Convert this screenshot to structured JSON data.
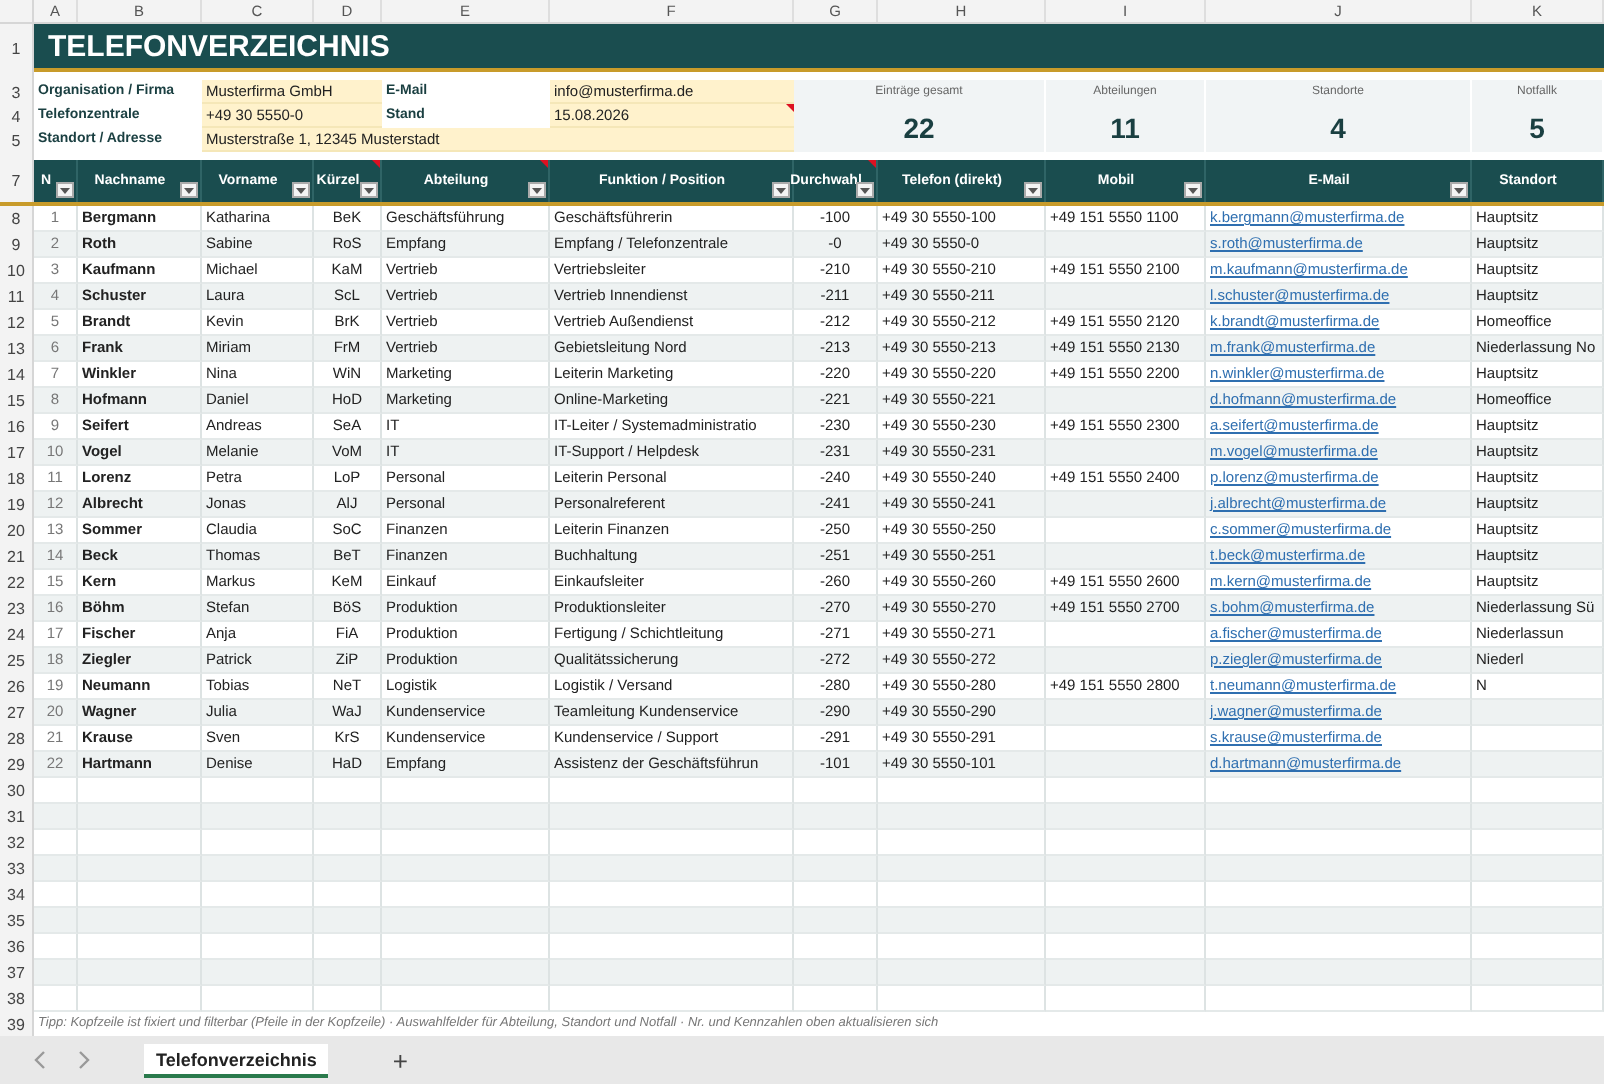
{
  "column_letters": [
    "A",
    "B",
    "C",
    "D",
    "E",
    "F",
    "G",
    "H",
    "I",
    "J",
    "K"
  ],
  "title": {
    "row_number": "1",
    "text": "TELEFONVERZEICHNIS"
  },
  "info": [
    {
      "row_number": "3",
      "label": "Organisation / Firma",
      "value": "Musterfirma GmbH",
      "label_2": "E-Mail",
      "value_2": "info@musterfirma.de",
      "comment": false
    },
    {
      "row_number": "4",
      "label": "Telefonzentrale",
      "value": "+49 30 5550-0",
      "label_2": "Stand",
      "value_2": "15.08.2026",
      "comment": true
    },
    {
      "row_number": "5",
      "label": "Standort / Adresse",
      "value": "Musterstraße 1, 12345 Musterstadt"
    }
  ],
  "kpis": [
    {
      "label": "Einträge gesamt",
      "value": "22"
    },
    {
      "label": "Abteilungen",
      "value": "11"
    },
    {
      "label": "Standorte",
      "value": "4"
    },
    {
      "label": "Notfallk",
      "value": "5"
    }
  ],
  "table": {
    "header_row_number": "7",
    "columns": [
      {
        "label": "N",
        "comment": false
      },
      {
        "label": "Nachname",
        "comment": false
      },
      {
        "label": "Vorname",
        "comment": false
      },
      {
        "label": "Kürzel",
        "comment": true
      },
      {
        "label": "Abteilung",
        "comment": true
      },
      {
        "label": "Funktion / Position",
        "comment": false
      },
      {
        "label": "Durchwahl",
        "comment": true
      },
      {
        "label": "Telefon (direkt)",
        "comment": false
      },
      {
        "label": "Mobil",
        "comment": false
      },
      {
        "label": "E-Mail",
        "comment": false
      },
      {
        "label": "Standort",
        "comment": false
      }
    ],
    "rows": [
      {
        "row_number": "8",
        "nr": "1",
        "last": "Bergmann",
        "first": "Katharina",
        "code": "BeK",
        "dept": "Geschäftsführung",
        "role": "Geschäftsführerin",
        "ext": "-100",
        "phone": "+49 30 5550-100",
        "mobile": "+49 151 5550 1100",
        "email": "k.bergmann@musterfirma.de",
        "site": "Hauptsitz"
      },
      {
        "row_number": "9",
        "nr": "2",
        "last": "Roth",
        "first": "Sabine",
        "code": "RoS",
        "dept": "Empfang",
        "role": "Empfang / Telefonzentrale",
        "ext": "-0",
        "phone": "+49 30 5550-0",
        "email": "s.roth@musterfirma.de",
        "site": "Hauptsitz"
      },
      {
        "row_number": "10",
        "nr": "3",
        "last": "Kaufmann",
        "first": "Michael",
        "code": "KaM",
        "dept": "Vertrieb",
        "role": "Vertriebsleiter",
        "ext": "-210",
        "phone": "+49 30 5550-210",
        "mobile": "+49 151 5550 2100",
        "email": "m.kaufmann@musterfirma.de",
        "site": "Hauptsitz"
      },
      {
        "row_number": "11",
        "nr": "4",
        "last": "Schuster",
        "first": "Laura",
        "code": "ScL",
        "dept": "Vertrieb",
        "role": "Vertrieb Innendienst",
        "ext": "-211",
        "phone": "+49 30 5550-211",
        "email": "l.schuster@musterfirma.de",
        "site": "Hauptsitz"
      },
      {
        "row_number": "12",
        "nr": "5",
        "last": "Brandt",
        "first": "Kevin",
        "code": "BrK",
        "dept": "Vertrieb",
        "role": "Vertrieb Außendienst",
        "ext": "-212",
        "phone": "+49 30 5550-212",
        "mobile": "+49 151 5550 2120",
        "email": "k.brandt@musterfirma.de",
        "site": "Homeoffice"
      },
      {
        "row_number": "13",
        "nr": "6",
        "last": "Frank",
        "first": "Miriam",
        "code": "FrM",
        "dept": "Vertrieb",
        "role": "Gebietsleitung Nord",
        "ext": "-213",
        "phone": "+49 30 5550-213",
        "mobile": "+49 151 5550 2130",
        "email": "m.frank@musterfirma.de",
        "site": "Niederlassung No"
      },
      {
        "row_number": "14",
        "nr": "7",
        "last": "Winkler",
        "first": "Nina",
        "code": "WiN",
        "dept": "Marketing",
        "role": "Leiterin Marketing",
        "ext": "-220",
        "phone": "+49 30 5550-220",
        "mobile": "+49 151 5550 2200",
        "email": "n.winkler@musterfirma.de",
        "site": "Hauptsitz"
      },
      {
        "row_number": "15",
        "nr": "8",
        "last": "Hofmann",
        "first": "Daniel",
        "code": "HoD",
        "dept": "Marketing",
        "role": "Online-Marketing",
        "ext": "-221",
        "phone": "+49 30 5550-221",
        "email": "d.hofmann@musterfirma.de",
        "site": "Homeoffice"
      },
      {
        "row_number": "16",
        "nr": "9",
        "last": "Seifert",
        "first": "Andreas",
        "code": "SeA",
        "dept": "IT",
        "role": "IT-Leiter / Systemadministratio",
        "ext": "-230",
        "phone": "+49 30 5550-230",
        "mobile": "+49 151 5550 2300",
        "email": "a.seifert@musterfirma.de",
        "site": "Hauptsitz"
      },
      {
        "row_number": "17",
        "nr": "10",
        "last": "Vogel",
        "first": "Melanie",
        "code": "VoM",
        "dept": "IT",
        "role": "IT-Support / Helpdesk",
        "ext": "-231",
        "phone": "+49 30 5550-231",
        "email": "m.vogel@musterfirma.de",
        "site": "Hauptsitz"
      },
      {
        "row_number": "18",
        "nr": "11",
        "last": "Lorenz",
        "first": "Petra",
        "code": "LoP",
        "dept": "Personal",
        "role": "Leiterin Personal",
        "ext": "-240",
        "phone": "+49 30 5550-240",
        "mobile": "+49 151 5550 2400",
        "email": "p.lorenz@musterfirma.de",
        "site": "Hauptsitz"
      },
      {
        "row_number": "19",
        "nr": "12",
        "last": "Albrecht",
        "first": "Jonas",
        "code": "AlJ",
        "dept": "Personal",
        "role": "Personalreferent",
        "ext": "-241",
        "phone": "+49 30 5550-241",
        "email": "j.albrecht@musterfirma.de",
        "site": "Hauptsitz"
      },
      {
        "row_number": "20",
        "nr": "13",
        "last": "Sommer",
        "first": "Claudia",
        "code": "SoC",
        "dept": "Finanzen",
        "role": "Leiterin Finanzen",
        "ext": "-250",
        "phone": "+49 30 5550-250",
        "email": "c.sommer@musterfirma.de",
        "site": "Hauptsitz"
      },
      {
        "row_number": "21",
        "nr": "14",
        "last": "Beck",
        "first": "Thomas",
        "code": "BeT",
        "dept": "Finanzen",
        "role": "Buchhaltung",
        "ext": "-251",
        "phone": "+49 30 5550-251",
        "email": "t.beck@musterfirma.de",
        "site": "Hauptsitz"
      },
      {
        "row_number": "22",
        "nr": "15",
        "last": "Kern",
        "first": "Markus",
        "code": "KeM",
        "dept": "Einkauf",
        "role": "Einkaufsleiter",
        "ext": "-260",
        "phone": "+49 30 5550-260",
        "mobile": "+49 151 5550 2600",
        "email": "m.kern@musterfirma.de",
        "site": "Hauptsitz"
      },
      {
        "row_number": "23",
        "nr": "16",
        "last": "Böhm",
        "first": "Stefan",
        "code": "BöS",
        "dept": "Produktion",
        "role": "Produktionsleiter",
        "ext": "-270",
        "phone": "+49 30 5550-270",
        "mobile": "+49 151 5550 2700",
        "email": "s.bohm@musterfirma.de",
        "site": "Niederlassung Sü"
      },
      {
        "row_number": "24",
        "nr": "17",
        "last": "Fischer",
        "first": "Anja",
        "code": "FiA",
        "dept": "Produktion",
        "role": "Fertigung / Schichtleitung",
        "ext": "-271",
        "phone": "+49 30 5550-271",
        "email": "a.fischer@musterfirma.de",
        "site": "Niederlassun"
      },
      {
        "row_number": "25",
        "nr": "18",
        "last": "Ziegler",
        "first": "Patrick",
        "code": "ZiP",
        "dept": "Produktion",
        "role": "Qualitätssicherung",
        "ext": "-272",
        "phone": "+49 30 5550-272",
        "email": "p.ziegler@musterfirma.de",
        "site": "Niederl"
      },
      {
        "row_number": "26",
        "nr": "19",
        "last": "Neumann",
        "first": "Tobias",
        "code": "NeT",
        "dept": "Logistik",
        "role": "Logistik / Versand",
        "ext": "-280",
        "phone": "+49 30 5550-280",
        "mobile": "+49 151 5550 2800",
        "email": "t.neumann@musterfirma.de",
        "site": "N"
      },
      {
        "row_number": "27",
        "nr": "20",
        "last": "Wagner",
        "first": "Julia",
        "code": "WaJ",
        "dept": "Kundenservice",
        "role": "Teamleitung Kundenservice",
        "ext": "-290",
        "phone": "+49 30 5550-290",
        "email": "j.wagner@musterfirma.de"
      },
      {
        "row_number": "28",
        "nr": "21",
        "last": "Krause",
        "first": "Sven",
        "code": "KrS",
        "dept": "Kundenservice",
        "role": "Kundenservice / Support",
        "ext": "-291",
        "phone": "+49 30 5550-291",
        "email": "s.krause@musterfirma.de"
      },
      {
        "row_number": "29",
        "nr": "22",
        "last": "Hartmann",
        "first": "Denise",
        "code": "HaD",
        "dept": "Empfang",
        "role": "Assistenz der Geschäftsführun",
        "ext": "-101",
        "phone": "+49 30 5550-101",
        "email": "d.hartmann@musterfirma.de"
      }
    ]
  },
  "empty_rows": [
    "30",
    "31",
    "32",
    "33",
    "34",
    "35",
    "36",
    "37",
    "38"
  ],
  "tip": {
    "row_number": "39",
    "text": "Tipp: Kopfzeile ist fixiert und filterbar (Pfeile in der Kopfzeile) · Auswahlfelder für Abteilung, Standort und Notfall · Nr. und Kennzahlen oben aktualisieren sich"
  },
  "sheet_tabs": [
    {
      "label": "Telefonverzeichnis",
      "selected": true
    }
  ],
  "add_sheet": "+"
}
